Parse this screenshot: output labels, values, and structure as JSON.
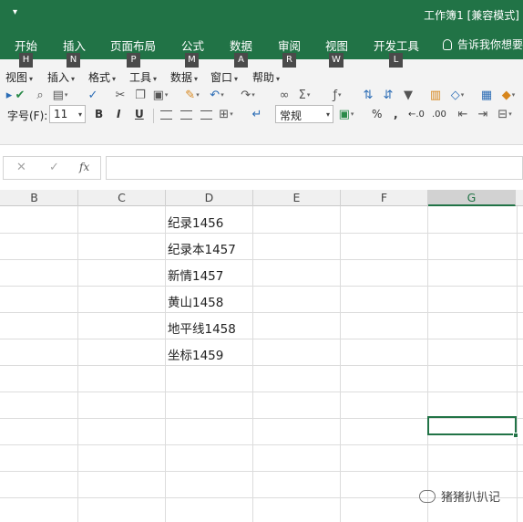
{
  "window": {
    "qat_arrow": "▾",
    "title": "工作簿1  [兼容模式]"
  },
  "ribbon_tabs": [
    {
      "label": "开始",
      "keytip": "H"
    },
    {
      "label": "插入",
      "keytip": "N"
    },
    {
      "label": "页面布局",
      "keytip": "P"
    },
    {
      "label": "公式",
      "keytip": "M"
    },
    {
      "label": "数据",
      "keytip": "A"
    },
    {
      "label": "审阅",
      "keytip": "R"
    },
    {
      "label": "视图",
      "keytip": "W"
    },
    {
      "label": "开发工具",
      "keytip": "L"
    }
  ],
  "tell_me": "告诉我你想要",
  "menu_bar": [
    {
      "label": "视图"
    },
    {
      "label": "插入"
    },
    {
      "label": "格式"
    },
    {
      "label": "工具"
    },
    {
      "label": "数据"
    },
    {
      "label": "窗口"
    },
    {
      "label": "帮助"
    }
  ],
  "toolbar_icons": [
    "spelling-icon",
    "check-icon",
    "print-preview-icon",
    "print-icon",
    "format-painter-icon",
    "cut-icon",
    "copy-icon",
    "paste-icon",
    "clear-icon",
    "undo-icon",
    "redo-icon",
    "link-icon",
    "autosum-icon",
    "function-icon",
    "sort-asc-icon",
    "sort-desc-icon",
    "filter-icon",
    "chart-icon",
    "shapes-icon",
    "table-icon",
    "warning-icon"
  ],
  "formatting": {
    "font_size_label": "字号(F):",
    "font_size_value": "11",
    "bold": "B",
    "italic": "I",
    "underline": "U",
    "number_format": "常规",
    "percent": "%",
    "comma": ",",
    "increase_decimal": "←.0",
    "decrease_decimal": ".00"
  },
  "formula_bar": {
    "cancel": "✕",
    "enter": "✓",
    "fx": "fx",
    "value": ""
  },
  "columns": [
    {
      "label": "B",
      "selected": false
    },
    {
      "label": "C",
      "selected": false
    },
    {
      "label": "D",
      "selected": false
    },
    {
      "label": "E",
      "selected": false
    },
    {
      "label": "F",
      "selected": false
    },
    {
      "label": "G",
      "selected": true
    }
  ],
  "cells_D": [
    "纪录1456",
    "纪录本1457",
    "新情1457",
    "黄山1458",
    "地平线1458",
    "坐标1459"
  ],
  "watermark": "猪猪扒扒记",
  "colors": {
    "ribbon": "#217346",
    "selection": "#217346"
  }
}
